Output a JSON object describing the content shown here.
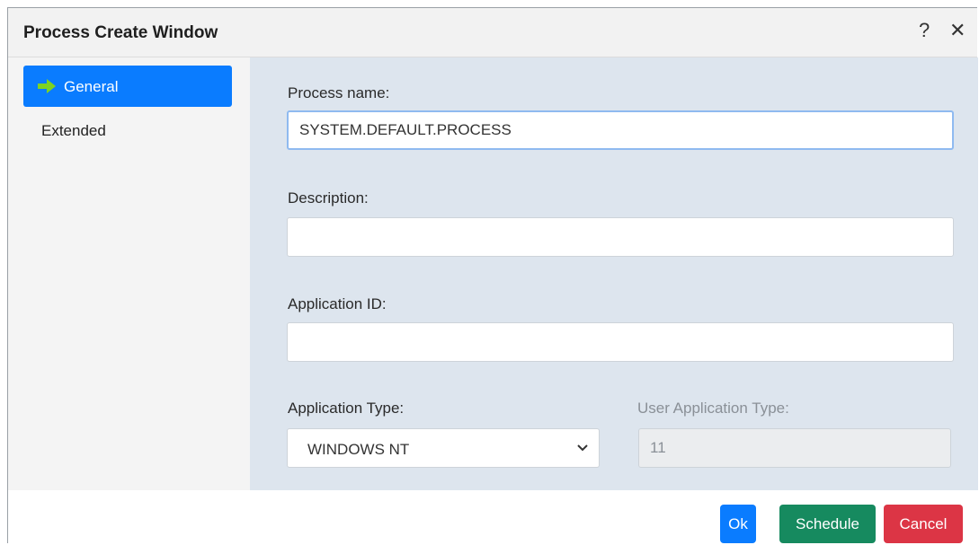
{
  "window": {
    "title": "Process Create Window",
    "help_icon": "question-mark-icon",
    "close_icon": "close-icon"
  },
  "sidebar": {
    "items": [
      {
        "label": "General",
        "icon": "right-arrow-icon",
        "active": true
      },
      {
        "label": "Extended",
        "active": false
      }
    ]
  },
  "form": {
    "process_name": {
      "label": "Process name:",
      "value": "SYSTEM.DEFAULT.PROCESS"
    },
    "description": {
      "label": "Description:",
      "value": ""
    },
    "application_id": {
      "label": "Application ID:",
      "value": ""
    },
    "application_type": {
      "label": "Application Type:",
      "selected": "WINDOWS NT"
    },
    "user_application_type": {
      "label": "User Application Type:",
      "value": "11"
    }
  },
  "buttons": {
    "ok": "Ok",
    "schedule": "Schedule",
    "cancel": "Cancel"
  },
  "colors": {
    "primary": "#0a7cff",
    "success": "#168a5f",
    "danger": "#dc3545",
    "panel": "#dde5ee"
  }
}
